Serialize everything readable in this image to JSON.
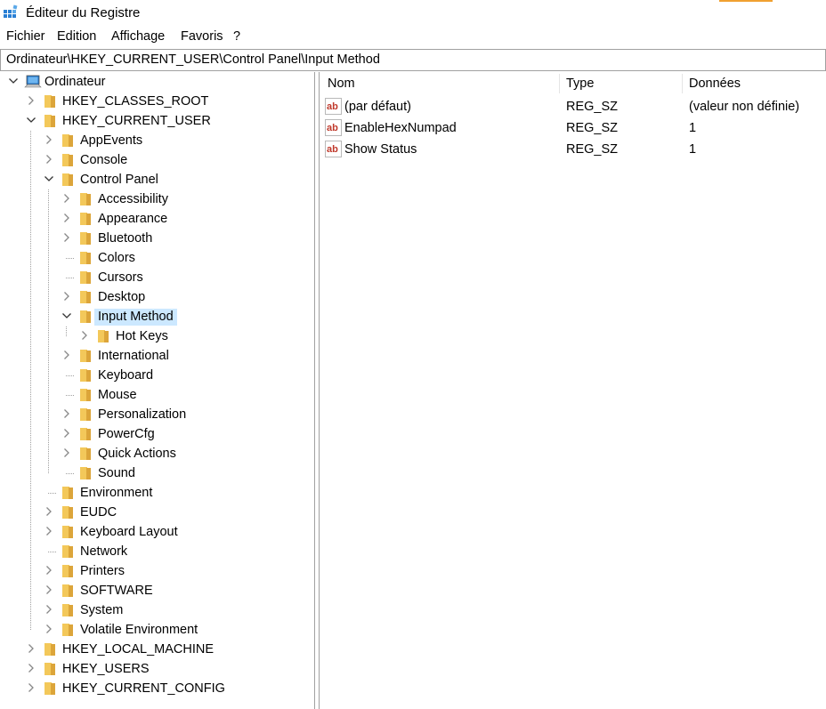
{
  "window": {
    "title": "Éditeur du Registre"
  },
  "menu": [
    "Fichier",
    "Edition",
    "Affichage",
    "Favoris",
    "?"
  ],
  "address": "Ordinateur\\HKEY_CURRENT_USER\\Control Panel\\Input Method",
  "tree": {
    "root": "Ordinateur",
    "nodes": [
      {
        "label": "HKEY_CLASSES_ROOT"
      },
      {
        "label": "HKEY_CURRENT_USER"
      },
      {
        "label": "AppEvents"
      },
      {
        "label": "Console"
      },
      {
        "label": "Control Panel"
      },
      {
        "label": "Accessibility"
      },
      {
        "label": "Appearance"
      },
      {
        "label": "Bluetooth"
      },
      {
        "label": "Colors"
      },
      {
        "label": "Cursors"
      },
      {
        "label": "Desktop"
      },
      {
        "label": "Input Method"
      },
      {
        "label": "Hot Keys"
      },
      {
        "label": "International"
      },
      {
        "label": "Keyboard"
      },
      {
        "label": "Mouse"
      },
      {
        "label": "Personalization"
      },
      {
        "label": "PowerCfg"
      },
      {
        "label": "Quick Actions"
      },
      {
        "label": "Sound"
      },
      {
        "label": "Environment"
      },
      {
        "label": "EUDC"
      },
      {
        "label": "Keyboard Layout"
      },
      {
        "label": "Network"
      },
      {
        "label": "Printers"
      },
      {
        "label": "SOFTWARE"
      },
      {
        "label": "System"
      },
      {
        "label": "Volatile Environment"
      },
      {
        "label": "HKEY_LOCAL_MACHINE"
      },
      {
        "label": "HKEY_USERS"
      },
      {
        "label": "HKEY_CURRENT_CONFIG"
      }
    ]
  },
  "list": {
    "columns": [
      "Nom",
      "Type",
      "Données"
    ],
    "rows": [
      {
        "name": "(par défaut)",
        "type": "REG_SZ",
        "data": "(valeur non définie)"
      },
      {
        "name": "EnableHexNumpad",
        "type": "REG_SZ",
        "data": "1"
      },
      {
        "name": "Show Status",
        "type": "REG_SZ",
        "data": "1"
      }
    ]
  },
  "colors": {
    "selection": "#cce8ff",
    "folder": "#e8b84a",
    "border": "#a0a0a0"
  }
}
